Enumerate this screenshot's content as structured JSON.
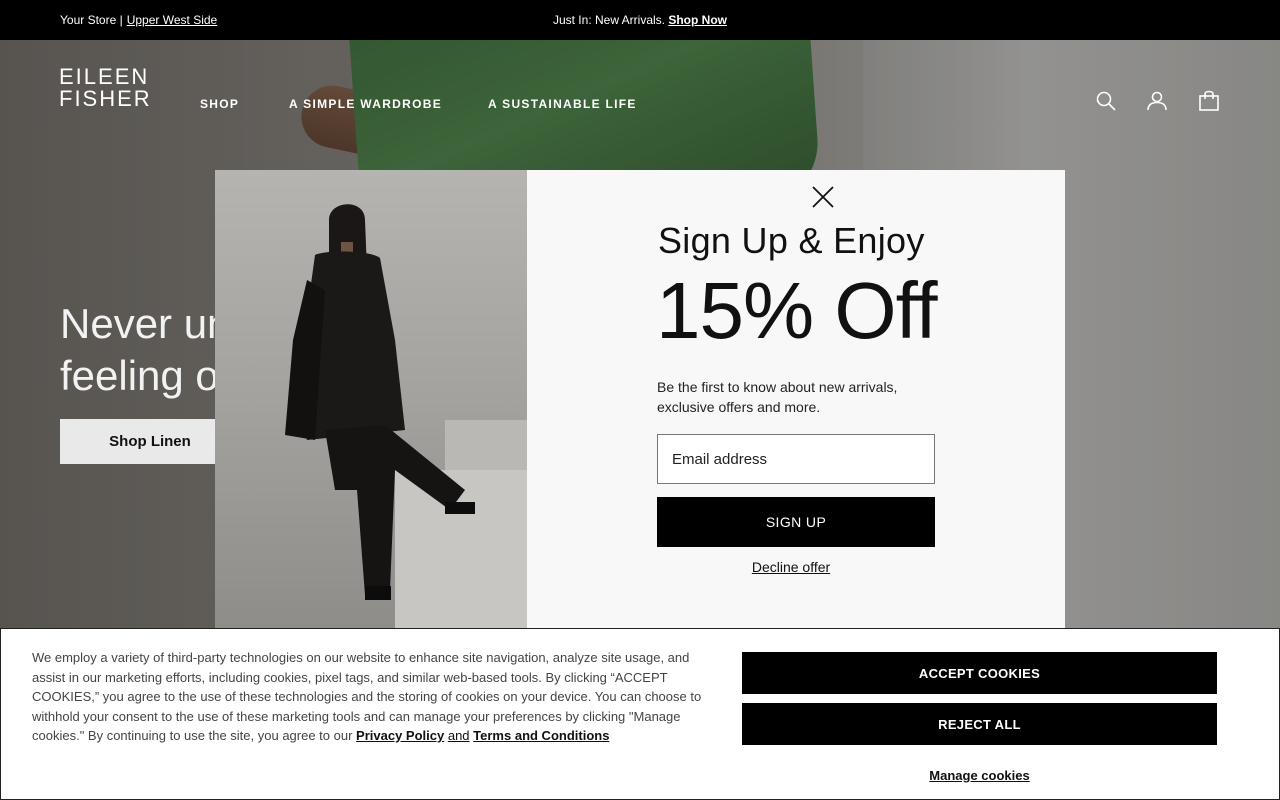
{
  "topbar": {
    "store_label": "Your Store |",
    "store_link": "Upper West Side",
    "promo_text": "Just In: New Arrivals.",
    "promo_link": "Shop Now"
  },
  "header": {
    "logo_line1": "EILEEN",
    "logo_line2": "FISHER",
    "nav": [
      "SHOP",
      "A SIMPLE WARDROBE",
      "A SUSTAINABLE LIFE"
    ],
    "icons": [
      "search-icon",
      "account-icon",
      "shopping-bag-icon"
    ]
  },
  "hero": {
    "title_line1": "Never underestimate the",
    "title_line2": "feeling of a really good outfit.",
    "cta_label": "Shop Linen"
  },
  "modal": {
    "heading": "Sign Up & Enjoy",
    "offer": "15% Off",
    "description": "Be the first to know about new arrivals, exclusive offers and more.",
    "email_placeholder": "Email address",
    "signup_label": "SIGN UP",
    "decline_label": "Decline offer"
  },
  "cookie_banner": {
    "text": "We employ a variety of third-party technologies on our website to enhance site navigation, analyze site usage, and assist in our marketing efforts, including cookies, pixel tags, and similar web-based tools. By clicking “ACCEPT COOKIES,” you agree to the use of these technologies and the storing of cookies on your device. You can choose to withhold your consent to the use of these marketing tools and can manage your preferences by clicking \"Manage cookies.\" By continuing to use the site, you agree to our",
    "privacy_link": "Privacy Policy",
    "and_text": "and",
    "terms_link": "Terms and Conditions",
    "accept_label": "ACCEPT COOKIES",
    "reject_label": "REJECT ALL",
    "manage_label": "Manage cookies"
  }
}
